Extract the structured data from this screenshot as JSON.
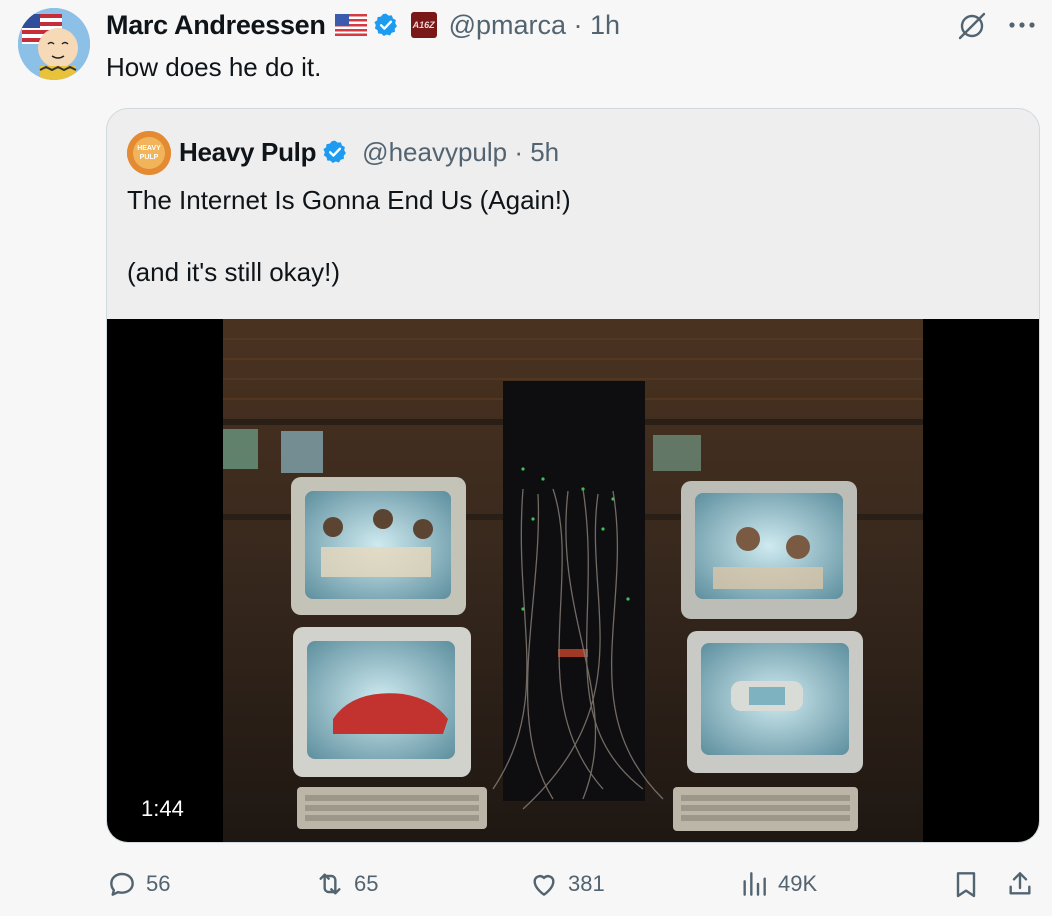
{
  "author": {
    "name": "Marc Andreessen",
    "handle": "@pmarca · 1h",
    "affiliate_badge": "A16Z",
    "text": "How does he do it."
  },
  "quoted": {
    "name": "Heavy Pulp",
    "handle": "@heavypulp · 5h",
    "avatar_text": "HEAVY PULP",
    "text_line1": "The Internet Is Gonna End Us (Again!)",
    "text_line2": "(and it's still okay!)",
    "video_duration": "1:44"
  },
  "actions": {
    "replies": "56",
    "reposts": "65",
    "likes": "381",
    "views": "49K"
  },
  "colors": {
    "verified": "#1d9bf0",
    "secondary_text": "#536471",
    "card_border": "#cfd9de"
  },
  "icons": [
    "grok-icon",
    "more-icon",
    "reply-icon",
    "repost-icon",
    "like-icon",
    "views-icon",
    "bookmark-icon",
    "share-icon"
  ]
}
